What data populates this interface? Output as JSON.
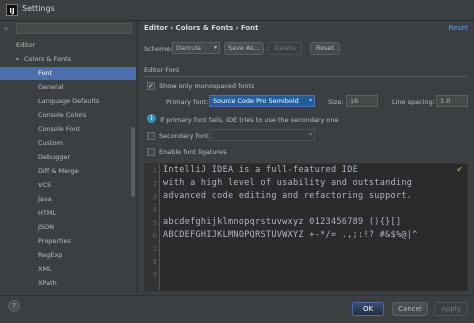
{
  "window": {
    "title": "Settings",
    "app_icon": "IJ"
  },
  "search": {
    "placeholder": ""
  },
  "tree": {
    "items": [
      {
        "label": "Editor",
        "level": 0
      },
      {
        "label": "Colors & Fonts",
        "level": 1,
        "expanded": true
      },
      {
        "label": "Font",
        "level": 2,
        "selected": true
      },
      {
        "label": "General",
        "level": 2
      },
      {
        "label": "Language Defaults",
        "level": 2
      },
      {
        "label": "Console Colors",
        "level": 2
      },
      {
        "label": "Console Font",
        "level": 2
      },
      {
        "label": "Custom",
        "level": 2
      },
      {
        "label": "Debugger",
        "level": 2
      },
      {
        "label": "Diff & Merge",
        "level": 2
      },
      {
        "label": "VCS",
        "level": 2
      },
      {
        "label": "Java",
        "level": 2
      },
      {
        "label": "HTML",
        "level": 2
      },
      {
        "label": "JSON",
        "level": 2
      },
      {
        "label": "Properties",
        "level": 2
      },
      {
        "label": "RegExp",
        "level": 2
      },
      {
        "label": "XML",
        "level": 2
      },
      {
        "label": "XPath",
        "level": 2
      }
    ]
  },
  "header": {
    "breadcrumb": "Editor › Colors & Fonts › Font",
    "reset_link": "Reset"
  },
  "scheme": {
    "label": "Scheme:",
    "value": "Darcula",
    "save_as": "Save As...",
    "delete": "Delete",
    "reset": "Reset"
  },
  "editor_font": {
    "section_title": "Editor Font",
    "show_monospaced_label": "Show only monospaced fonts",
    "show_monospaced_checked": true,
    "primary_font_label": "Primary font:",
    "primary_font_value": "Source Code Pro Semibold",
    "size_label": "Size:",
    "size_value": "16",
    "line_spacing_label": "Line spacing:",
    "line_spacing_value": "1.0",
    "info_text": "If primary font fails, IDE tries to use the secondary one",
    "secondary_font_label": "Secondary font:",
    "secondary_font_checked": false,
    "ligatures_label": "Enable font ligatures",
    "ligatures_checked": false
  },
  "preview": {
    "lines": [
      "IntelliJ IDEA is a full-featured IDE",
      "with a high level of usability and outstanding",
      "advanced code editing and refactoring support.",
      "",
      "abcdefghijklmnopqrstuvwxyz 0123456789 (){}[]",
      "ABCDEFGHIJKLMNOPQRSTUVWXYZ +-*/= .,;:!? #&$%@|^",
      "",
      "",
      ""
    ],
    "line_numbers": [
      "1",
      "2",
      "3",
      "4",
      "5",
      "6",
      "7",
      "8",
      "9"
    ]
  },
  "footer": {
    "help": "?",
    "ok": "OK",
    "cancel": "Cancel",
    "apply": "Apply"
  },
  "colors": {
    "background": "#3c3f41",
    "selection": "#4b6eaf",
    "link": "#589df6",
    "editor_bg": "#2b2b2b",
    "editor_text": "#a9b7c6"
  }
}
